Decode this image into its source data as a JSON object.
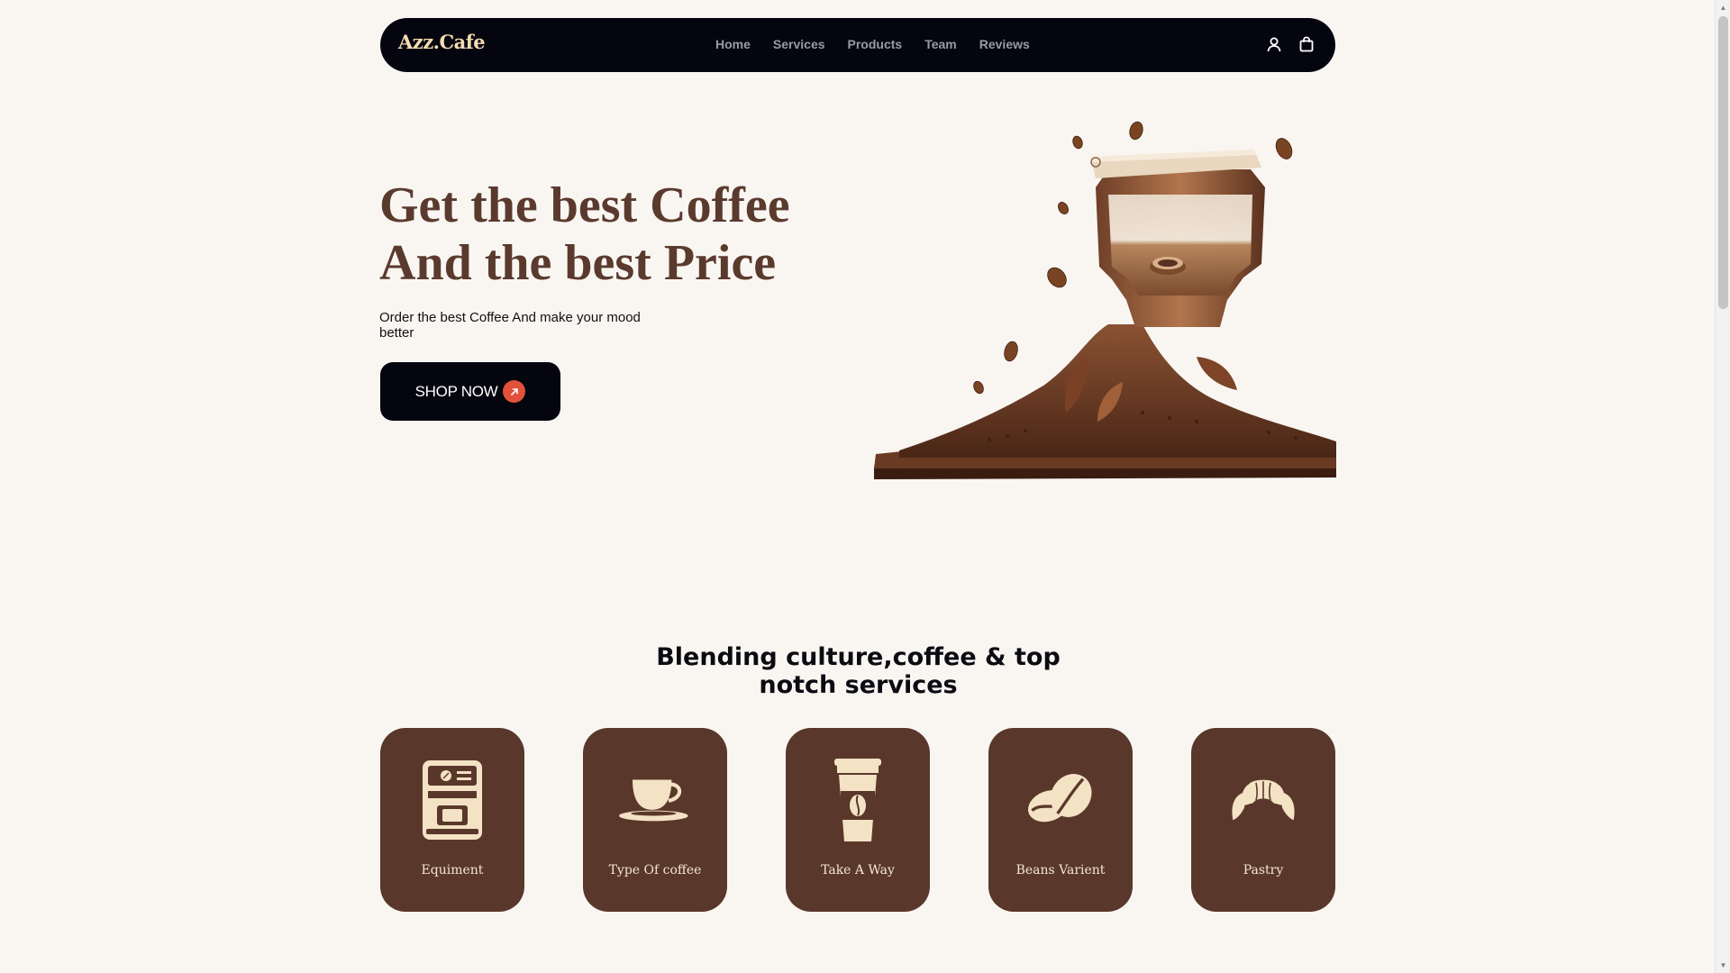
{
  "nav": {
    "logo": "Azz.Cafe",
    "links": [
      "Home",
      "Services",
      "Products",
      "Team",
      "Reviews"
    ],
    "icons": [
      "user-icon",
      "shopping-bag-icon"
    ]
  },
  "hero": {
    "title_line1": "Get the best Coffee",
    "title_line2": "And the best Price",
    "subtitle": "Order the best Coffee And make your mood better",
    "cta_label": "SHOP NOW",
    "cta_icon": "arrow-right-icon"
  },
  "services": {
    "title": "Blending culture,coffee & top notch services",
    "cards": [
      {
        "label": "Equiment",
        "icon": "espresso-machine-icon"
      },
      {
        "label": "Type Of coffee",
        "icon": "coffee-cup-icon"
      },
      {
        "label": "Take A Way",
        "icon": "takeaway-cup-icon"
      },
      {
        "label": "Beans Varient",
        "icon": "coffee-beans-icon"
      },
      {
        "label": "Pastry",
        "icon": "croissant-icon"
      }
    ]
  },
  "colors": {
    "background": "#f9f6f2",
    "navbar": "#05050f",
    "logo": "#f3dcb2",
    "brown": "#5b3a2e",
    "card": "#5a372b",
    "accent": "#e2513a"
  }
}
